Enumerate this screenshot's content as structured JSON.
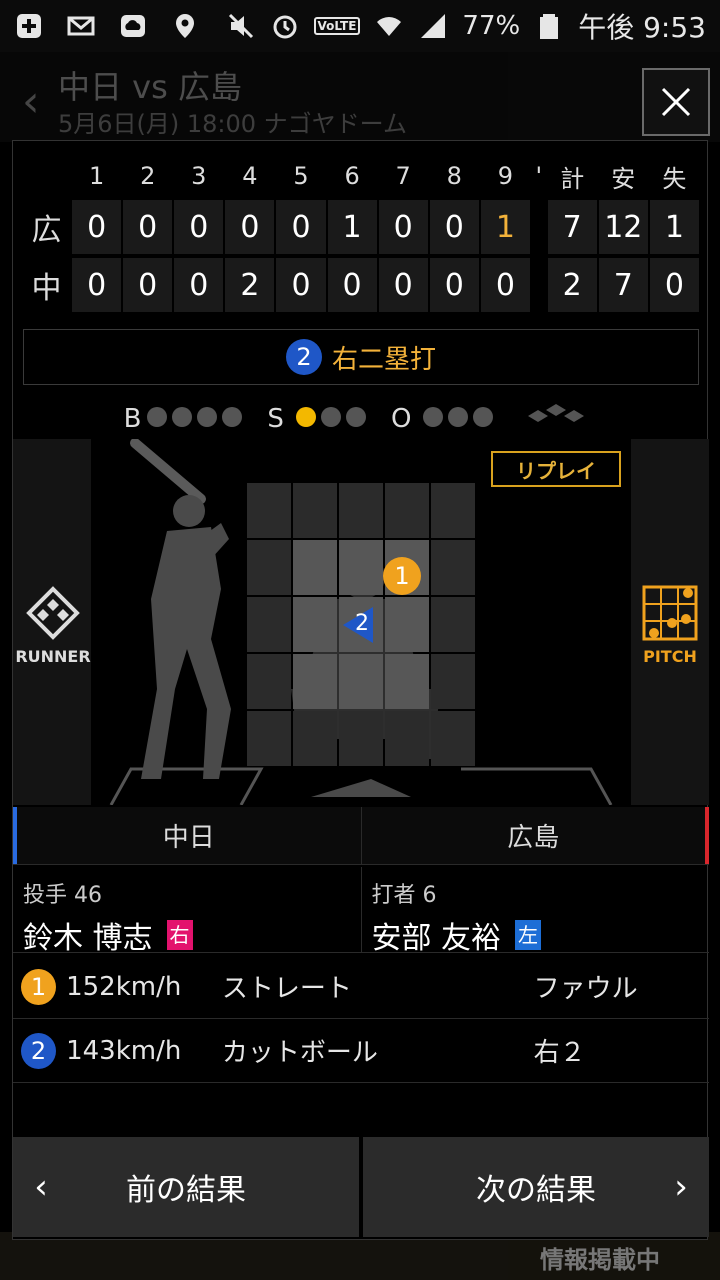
{
  "status_bar": {
    "battery": "77%",
    "time": "午後 9:53",
    "volte": "VoLTE"
  },
  "background_page": {
    "title": "中日 vs 広島",
    "subtitle": "5月6日(月) 18:00 ナゴヤドーム",
    "footer_text": "情報掲載中"
  },
  "scoreboard": {
    "innings": [
      "1",
      "2",
      "3",
      "4",
      "5",
      "6",
      "7",
      "8",
      "9"
    ],
    "extra_mark": "'",
    "total_headers": [
      "計",
      "安",
      "失"
    ],
    "rows": [
      {
        "team": "広",
        "scores": [
          "0",
          "0",
          "0",
          "0",
          "0",
          "1",
          "0",
          "0",
          "1"
        ],
        "totals": [
          "7",
          "12",
          "1"
        ]
      },
      {
        "team": "中",
        "scores": [
          "0",
          "0",
          "0",
          "2",
          "0",
          "0",
          "0",
          "0",
          "0"
        ],
        "totals": [
          "2",
          "7",
          "0"
        ]
      }
    ]
  },
  "play": {
    "pitch_no": "2",
    "result": "右二塁打"
  },
  "count": {
    "b_label": "B",
    "s_label": "S",
    "o_label": "O",
    "balls": 0,
    "strikes": 1,
    "outs": 0
  },
  "field": {
    "replay_label": "リプレイ",
    "runner_label": "RUNNER",
    "pitch_label": "PITCH",
    "ball1": "1",
    "ball2": "2"
  },
  "teams": {
    "left": "中日",
    "right": "広島"
  },
  "players": {
    "pitcher_role": "投手 46",
    "pitcher_name": "鈴木 博志",
    "pitcher_hand": "右",
    "batter_role": "打者 6",
    "batter_name": "安部 友裕",
    "batter_hand": "左"
  },
  "pitches": [
    {
      "no": "1",
      "speed": "152km/h",
      "type": "ストレート",
      "result": "ファウル"
    },
    {
      "no": "2",
      "speed": "143km/h",
      "type": "カットボール",
      "result": "右２"
    }
  ],
  "nav": {
    "prev": "前の結果",
    "next": "次の結果"
  },
  "colors": {
    "accent_orange": "#f0a21e",
    "accent_blue": "#1f57c7",
    "strike_yellow": "#f3b800",
    "home_red": "#d8262c",
    "visitor_blue": "#2a6be0"
  }
}
